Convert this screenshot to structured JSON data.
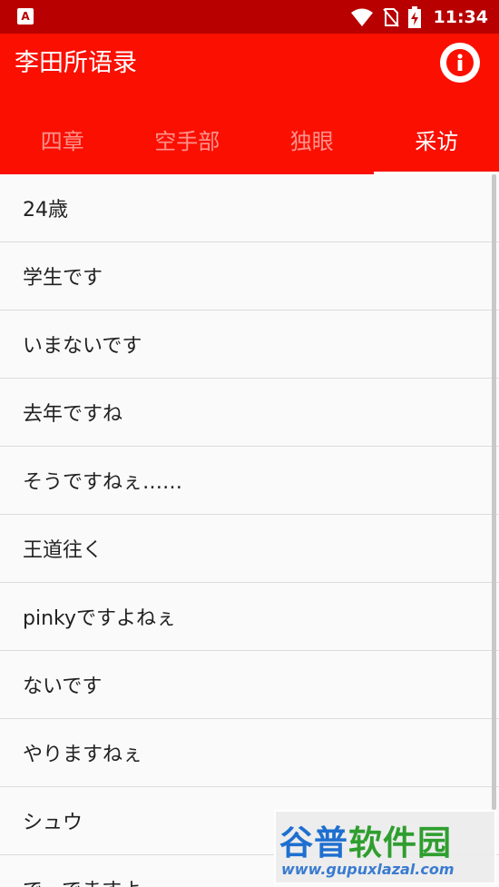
{
  "status_bar": {
    "left_icon": "A",
    "time": "11:34",
    "icons": [
      "wifi-icon",
      "no-sim-icon",
      "battery-charging-icon"
    ]
  },
  "app_bar": {
    "title": "李田所语录",
    "info_icon": "info-icon"
  },
  "tabs": [
    {
      "label": "四章"
    },
    {
      "label": "空手部"
    },
    {
      "label": "独眼"
    },
    {
      "label": "采访"
    }
  ],
  "active_tab": "采访",
  "list_items": [
    "24歳",
    "学生です",
    "いまないです",
    "去年ですね",
    "そうですねぇ……",
    "王道往く",
    "pinkyですよねぇ",
    "ないです",
    "やりますねぇ",
    "シュウ",
    "で、でますよ"
  ],
  "watermark": {
    "logo_part1": "谷普",
    "logo_part2": "软件园",
    "url": "www.gupuxlazal.com"
  },
  "colors": {
    "status_bar": "#b80000",
    "app_bar": "#fa0f00"
  }
}
